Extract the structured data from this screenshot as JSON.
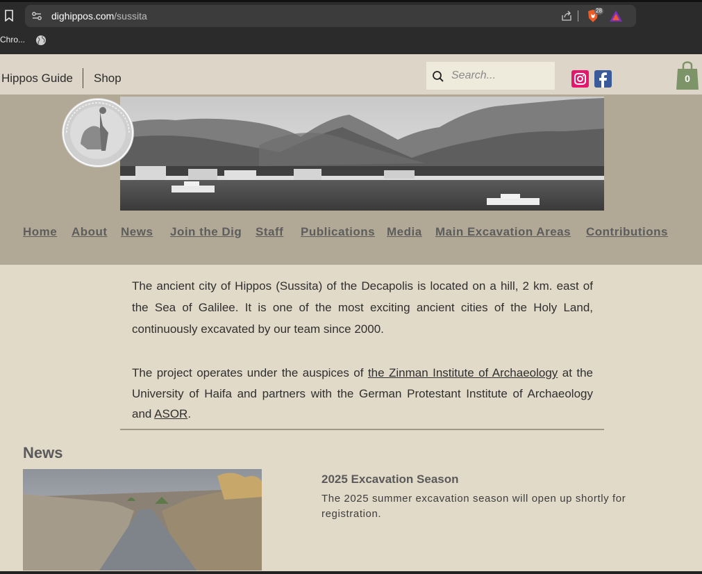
{
  "browser": {
    "url_domain": "dighippos.com",
    "url_path": "/sussita",
    "brave_badge": "28",
    "bookmark_label": "Chro..."
  },
  "header": {
    "guide_label": "Hippos Guide",
    "shop_label": "Shop",
    "search_placeholder": "Search...",
    "cart_count": "0"
  },
  "nav": {
    "items": [
      {
        "label": "Home"
      },
      {
        "label": "About"
      },
      {
        "label": "News"
      },
      {
        "label": "Join the Dig"
      },
      {
        "label": "Staff"
      },
      {
        "label": "Publications"
      },
      {
        "label": "Media"
      },
      {
        "label": "Main Excavation Areas"
      },
      {
        "label": "Contributions"
      }
    ]
  },
  "intro": {
    "p1": "The ancient city of Hippos (Sussita) of the Decapolis is located on a hill, 2 km. east of the Sea of Galilee. It is one of the most exciting ancient cities of the Holy Land, continuously excavated by our team since 2000.",
    "p2_start": "The project operates under the auspices of ",
    "p2_link1": "the Zinman Institute of Archaeology",
    "p2_mid": " at the University of Haifa and partners with the German Protestant Institute of Archaeology and ",
    "p2_link2": "ASOR",
    "p2_end": "."
  },
  "news": {
    "heading": "News",
    "item_title": "2025 Excavation Season",
    "item_desc": "The 2025 summer excavation season will open up shortly for registration."
  },
  "colors": {
    "chrome": "#2b2b2b",
    "header_bg": "#ddd5c7",
    "banner_bg": "#b1a995",
    "page_bg": "#e2dac8",
    "cart_green": "#7c9468"
  }
}
